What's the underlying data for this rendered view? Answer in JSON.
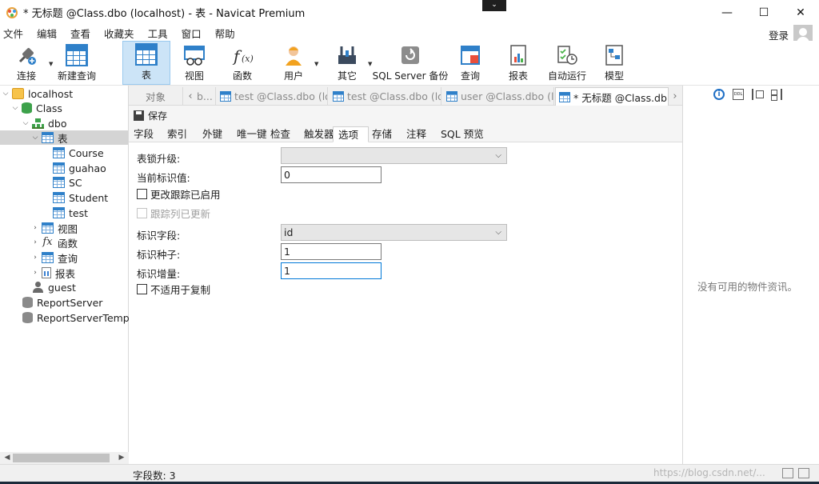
{
  "window": {
    "title": "* 无标题 @Class.dbo (localhost) - 表 - Navicat Premium",
    "collapse_glyph": "⌄",
    "controls": {
      "minimize": "—",
      "maximize": "☐",
      "close": "✕"
    }
  },
  "menubar": {
    "items": [
      "文件",
      "编辑",
      "查看",
      "收藏夹",
      "工具",
      "窗口",
      "帮助"
    ],
    "login": "登录"
  },
  "toolbar": {
    "items": [
      {
        "label": "连接",
        "icon": "plug-icon"
      },
      {
        "label": "新建查询",
        "icon": "new-query-icon"
      },
      {
        "label": "表",
        "icon": "table-icon",
        "active": true
      },
      {
        "label": "视图",
        "icon": "view-icon"
      },
      {
        "label": "函数",
        "icon": "function-icon"
      },
      {
        "label": "用户",
        "icon": "user-icon"
      },
      {
        "label": "其它",
        "icon": "tools-icon"
      },
      {
        "label": "SQL Server 备份",
        "icon": "backup-icon"
      },
      {
        "label": "查询",
        "icon": "query-icon"
      },
      {
        "label": "报表",
        "icon": "report-icon"
      },
      {
        "label": "自动运行",
        "icon": "auto-run-icon"
      },
      {
        "label": "模型",
        "icon": "model-icon"
      }
    ]
  },
  "tree": {
    "server": "localhost",
    "database": "Class",
    "schema": "dbo",
    "tables_group": "表",
    "tables": [
      "Course",
      "guahao",
      "SC",
      "Student",
      "test"
    ],
    "groups": [
      "视图",
      "函数",
      "查询",
      "报表"
    ],
    "user": "guest",
    "other_dbs": [
      "ReportServer",
      "ReportServerTempD"
    ]
  },
  "tabs": {
    "objects": "对象",
    "items": [
      {
        "label": "b...",
        "icon": "table-icon"
      },
      {
        "label": "test @Class.dbo (lo...",
        "icon": "table-icon"
      },
      {
        "label": "test @Class.dbo (lo...",
        "icon": "table-icon"
      },
      {
        "label": "user @Class.dbo (l...",
        "icon": "table-icon"
      },
      {
        "label": "* 无标题 @Class.db...",
        "icon": "table-design-icon",
        "active": true
      }
    ]
  },
  "editor": {
    "save_label": "保存",
    "subtabs": [
      "字段",
      "索引",
      "外键",
      "唯一键",
      "检查",
      "触发器",
      "选项",
      "存储",
      "注释",
      "SQL 预览"
    ],
    "active_subtab": "选项",
    "fields": {
      "lock_escalation_label": "表锁升级:",
      "lock_escalation_value": "",
      "current_identity_label": "当前标识值:",
      "current_identity_value": "0",
      "change_tracking_label": "更改跟踪已启用",
      "track_columns_label": "跟踪列已更新",
      "identity_field_label": "标识字段:",
      "identity_field_value": "id",
      "identity_seed_label": "标识种子:",
      "identity_seed_value": "1",
      "identity_increment_label": "标识增量:",
      "identity_increment_value": "1",
      "not_for_replication_label": "不适用于复制"
    }
  },
  "info_panel": {
    "message": "没有可用的物件资讯。"
  },
  "statusbar": {
    "field_count": "字段数: 3",
    "watermark": "https://blog.csdn.net/..."
  },
  "colors": {
    "accent": "#2f80c9",
    "active_tool_bg": "#cce4f7",
    "selected_tree_bg": "#d4d4d4",
    "focus_border": "#0078d7"
  }
}
